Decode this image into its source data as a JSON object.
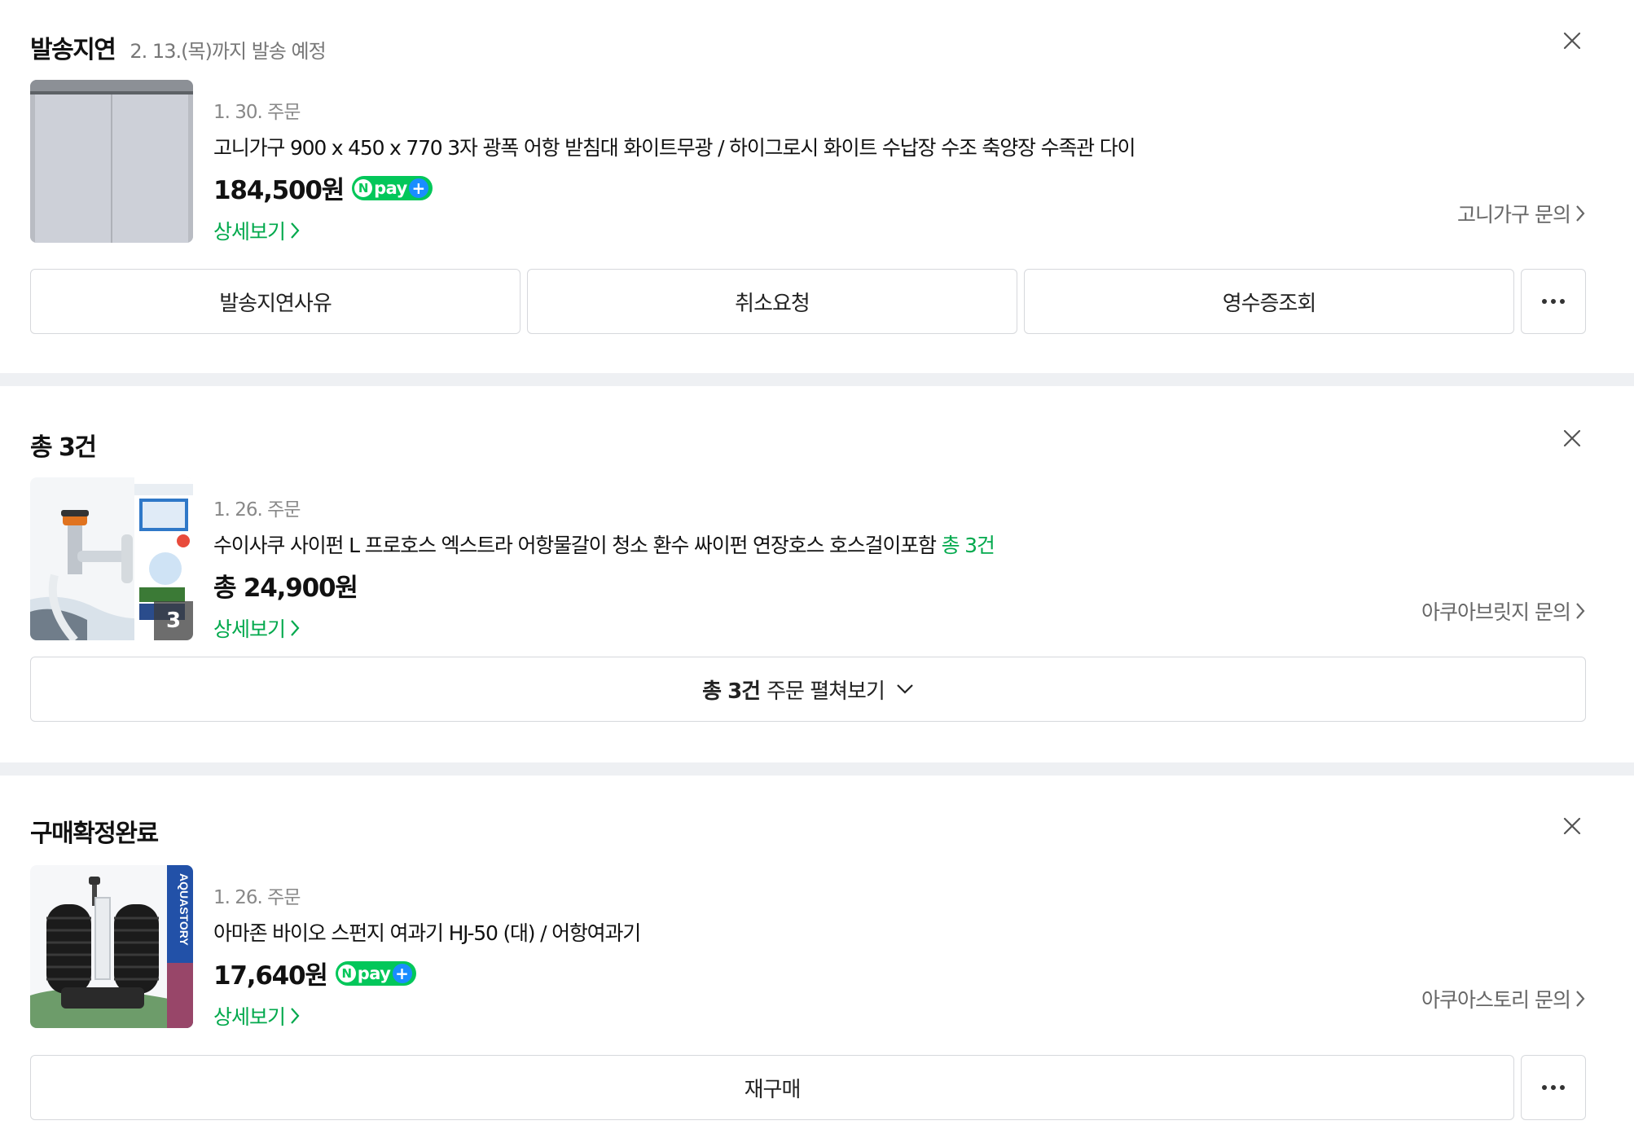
{
  "cards": [
    {
      "status": "발송지연",
      "status_note": "2. 13.(목)까지 발송 예정",
      "order_date": "1. 30. 주문",
      "product_name": "고니가구 900 x 450 x 770 3자 광폭 어항 받침대 화이트무광 / 하이그로시 화이트 수납장 수조 축양장 수족관 다이",
      "price": "184,500원",
      "npay_badge": "pay",
      "detail_label": "상세보기",
      "inquiry_label": "고니가구 문의",
      "buttons": [
        "발송지연사유",
        "취소요청",
        "영수증조회"
      ]
    },
    {
      "status": "총 3건",
      "order_date": "1. 26. 주문",
      "product_name": "수이사쿠 사이펀 L 프로호스 엑스트라 어항물갈이 청소 환수 싸이펀 연장호스 호스걸이포함",
      "product_count": "총 3건",
      "price": "총 24,900원",
      "thumb_count": "3",
      "detail_label": "상세보기",
      "inquiry_label": "아쿠아브릿지 문의",
      "expand_bold": "총 3건",
      "expand_rest": "주문 펼쳐보기"
    },
    {
      "status": "구매확정완료",
      "order_date": "1. 26. 주문",
      "product_name": "아마존 바이오 스펀지 여과기 HJ-50 (대) / 어항여과기",
      "price": "17,640원",
      "npay_badge": "pay",
      "detail_label": "상세보기",
      "inquiry_label": "아쿠아스토리 문의",
      "buttons": [
        "재구매"
      ],
      "thumb_brand": "AQUASTORY"
    }
  ],
  "icons": {
    "close": "close-icon",
    "more": "more-dots-icon",
    "chevron_right": "chevron-right-icon",
    "chevron_down": "chevron-down-icon"
  },
  "colors": {
    "accent_green": "#03a94d",
    "npay_green": "#03c75a",
    "npay_plus_blue": "#1a8dff",
    "separator": "#eef0f3"
  }
}
